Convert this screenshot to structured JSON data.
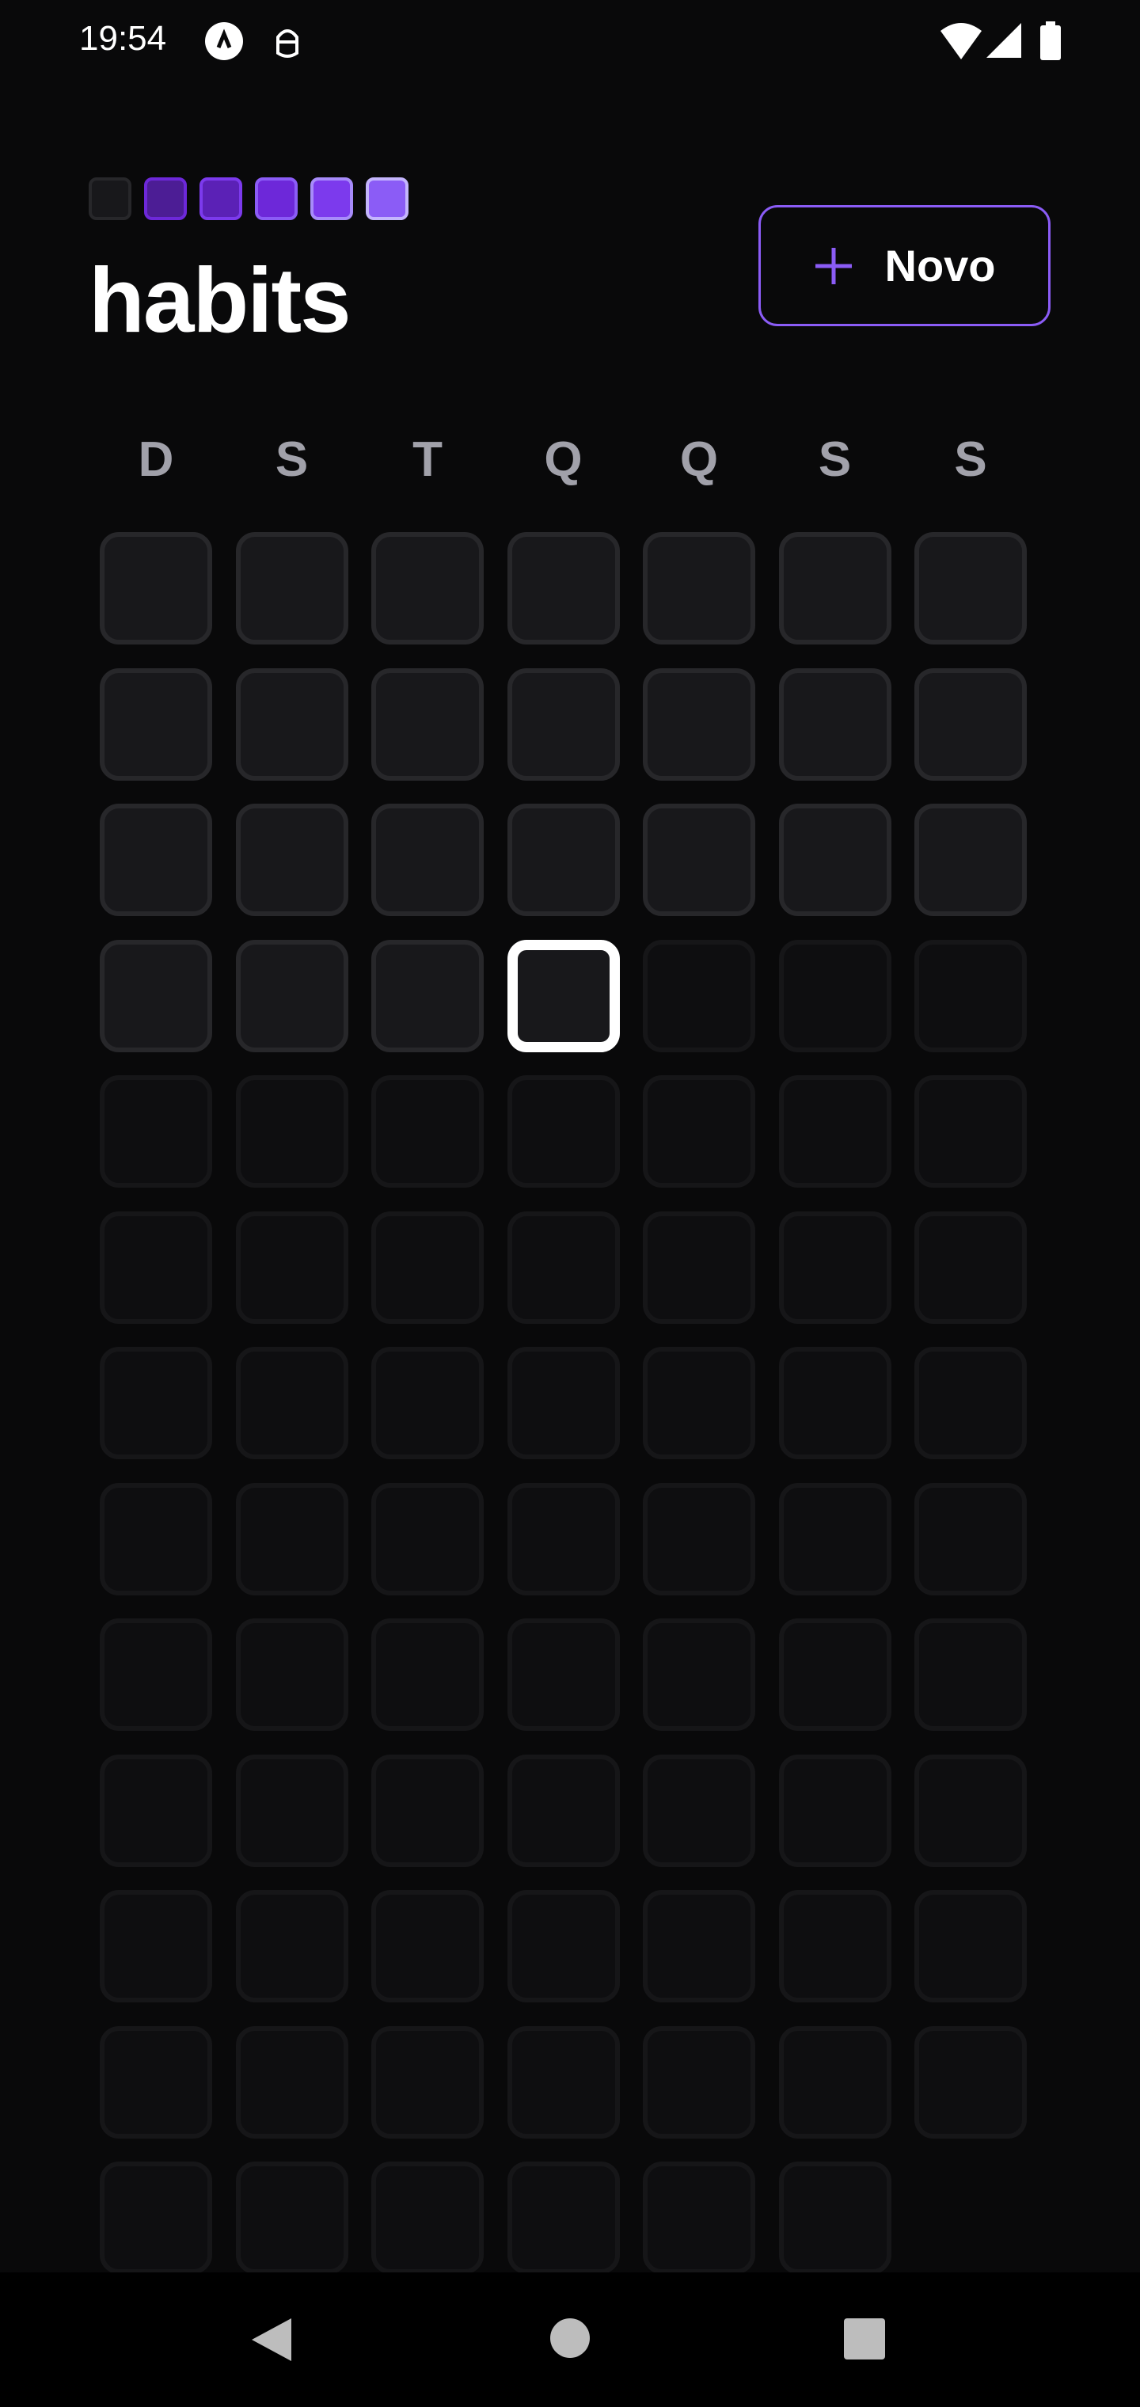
{
  "status_bar": {
    "time": "19:54",
    "icons": [
      "app-notification-icon",
      "android-debug-icon",
      "wifi-icon",
      "cell-signal-icon",
      "battery-icon"
    ]
  },
  "legend": {
    "colors": [
      "#18181b",
      "#4c1d95",
      "#5b21b6",
      "#6d28d9",
      "#7c3aed",
      "#8b5cf6"
    ],
    "borders": [
      "#27272a",
      "#6d28d9",
      "#7c3aed",
      "#8b5cf6",
      "#a78bfa",
      "#c4b5fd"
    ]
  },
  "header": {
    "title": "habits",
    "new_button_label": "Novo",
    "accent": "#8b5cf6"
  },
  "weekdays": [
    "D",
    "S",
    "T",
    "Q",
    "Q",
    "S",
    "S"
  ],
  "grid": {
    "total_days": 90,
    "past_days": 24,
    "today_index": 24
  },
  "nav": {
    "icons": [
      "back-icon",
      "home-icon",
      "recents-icon"
    ]
  }
}
